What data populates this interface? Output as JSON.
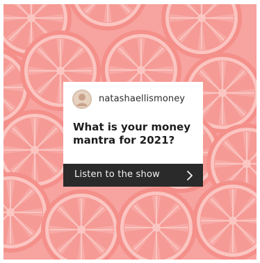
{
  "post": {
    "username": "natashaellismoney",
    "headline": "What is your money mantra for 2021?",
    "cta_label": "Listen to the show"
  },
  "icons": {
    "avatar": "profile-avatar",
    "cta": "chevron-right-icon",
    "background": "grapefruit-slices"
  },
  "colors": {
    "background": "#f7a3a0",
    "card": "#ffffff",
    "cta_bar": "#2a2a2a",
    "cta_text": "#f4f4f4",
    "headline": "#1d1d1d"
  }
}
